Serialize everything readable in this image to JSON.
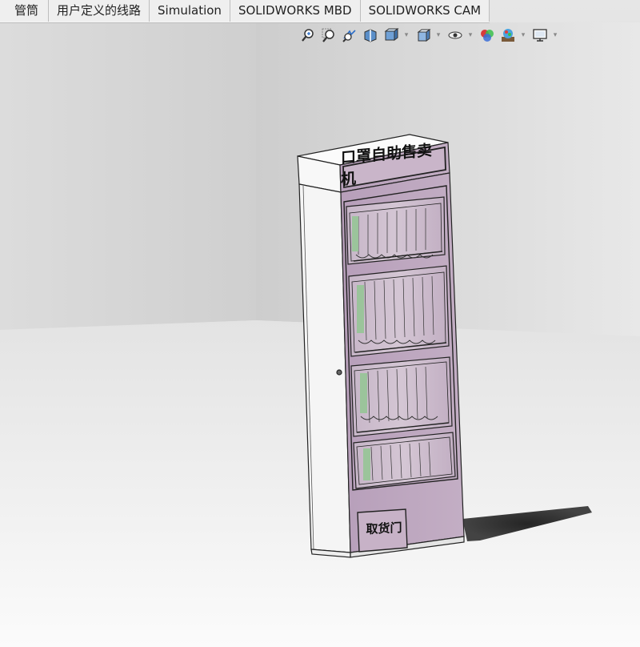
{
  "tabs": [
    {
      "label": "管筒"
    },
    {
      "label": "用户定义的线路"
    },
    {
      "label": "Simulation"
    },
    {
      "label": "SOLIDWORKS MBD"
    },
    {
      "label": "SOLIDWORKS CAM"
    }
  ],
  "hud_toolbar": [
    {
      "icon": "zoom-to-fit-icon"
    },
    {
      "icon": "zoom-to-area-icon"
    },
    {
      "icon": "previous-view-icon"
    },
    {
      "icon": "section-view-icon"
    },
    {
      "icon": "dynamic-annotation-views-icon",
      "dropdown": true
    },
    {
      "icon": "view-orientation-icon",
      "dropdown": true
    },
    {
      "icon": "display-style-icon",
      "dropdown": true
    },
    {
      "icon": "hide-show-items-icon",
      "dropdown": false
    },
    {
      "icon": "edit-appearance-icon",
      "dropdown": false
    },
    {
      "icon": "apply-scene-icon",
      "dropdown": true
    },
    {
      "icon": "view-settings-icon",
      "dropdown": true
    }
  ],
  "model": {
    "sign_text": "口罩自助售卖机",
    "door_text": "取货门"
  },
  "colors": {
    "panel_purple": "#b9a3bb",
    "cabinet_white": "#f6f6f6",
    "outline": "#222222",
    "floor": "#f4f4f4",
    "wall": "#dadada"
  }
}
